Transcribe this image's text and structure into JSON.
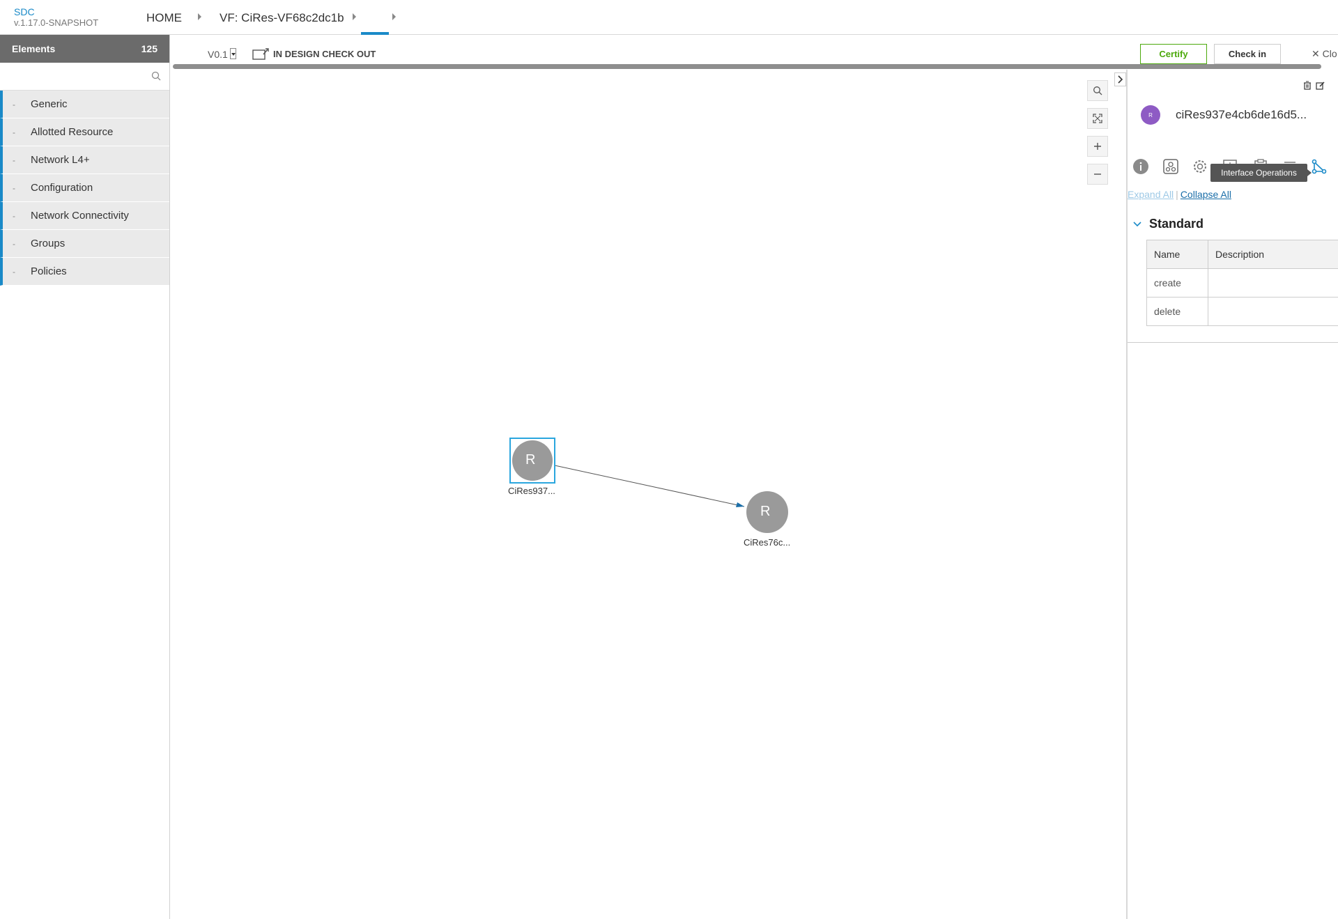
{
  "header": {
    "brand": "SDC",
    "version": "v.1.17.0-SNAPSHOT",
    "breadcrumbs": [
      "HOME",
      "VF: CiRes-VF68c2dc1b",
      ""
    ]
  },
  "palette": {
    "title": "Elements",
    "count": "125",
    "search_placeholder": "",
    "categories": [
      "Generic",
      "Allotted Resource",
      "Network L4+",
      "Configuration",
      "Network Connectivity",
      "Groups",
      "Policies"
    ]
  },
  "toolbar": {
    "version": "V0.1",
    "status": "IN DESIGN CHECK OUT",
    "certify_label": "Certify",
    "checkin_label": "Check in",
    "close_label": "Clo"
  },
  "canvas": {
    "nodes": [
      {
        "letter": "R",
        "label": "CiRes937..."
      },
      {
        "letter": "R",
        "label": "CiRes76c..."
      }
    ]
  },
  "details": {
    "component_initial": "R",
    "component_name": "ciRes937e4cb6de16d5...",
    "tooltip": "Interface Operations",
    "expand_all": "Expand All",
    "separator": "|",
    "collapse_all": "Collapse All",
    "section_title": "Standard",
    "table": {
      "headers": [
        "Name",
        "Description"
      ],
      "rows": [
        {
          "name": "create",
          "description": ""
        },
        {
          "name": "delete",
          "description": ""
        }
      ]
    }
  },
  "colors": {
    "accent": "#1a8ac8",
    "certify": "#4ca90c",
    "component_icon": "#8e5bc4",
    "node_fill": "#9a9a9a"
  }
}
